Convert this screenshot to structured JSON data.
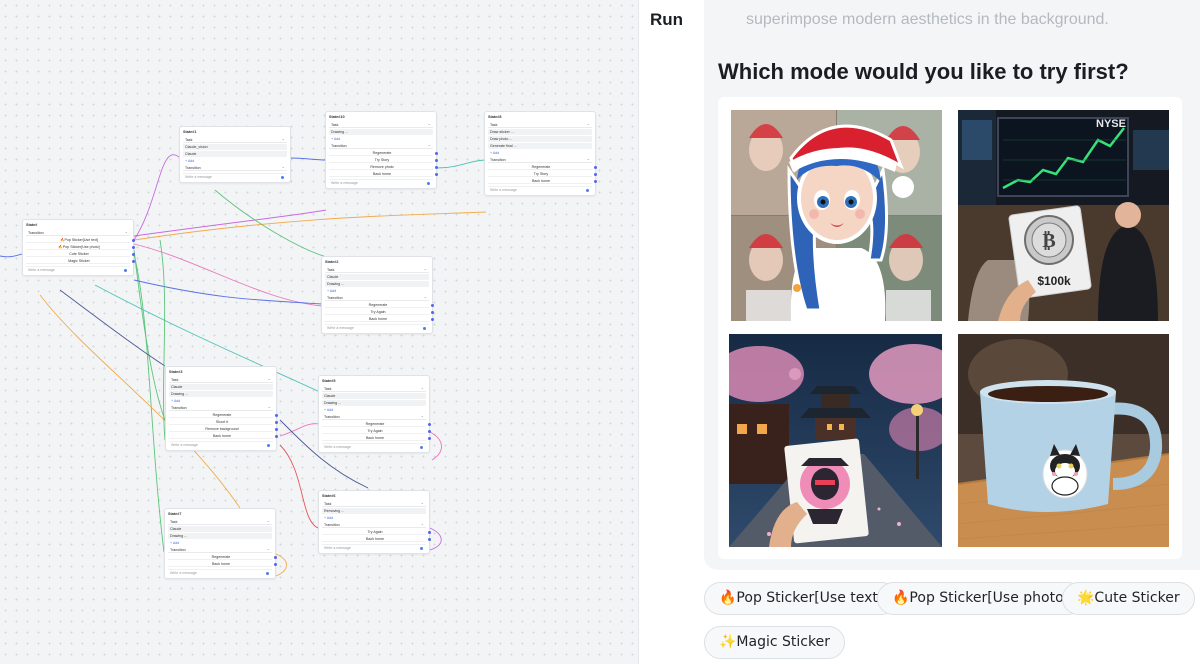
{
  "run_panel": {
    "title": "Run",
    "faded_message": "superimpose modern aesthetics in the background.",
    "question": "Which mode would you like to try first?",
    "images": [
      {
        "name": "christmas-girl-sticker",
        "sticker_text": ""
      },
      {
        "name": "bitcoin-stock-exchange-sticker",
        "sticker_text": "$100k"
      },
      {
        "name": "ninja-pagoda-sticker",
        "sticker_text": ""
      },
      {
        "name": "cat-mug-sticker",
        "sticker_text": ""
      }
    ],
    "buttons": [
      {
        "name": "pop-sticker-text-button",
        "label": "🔥Pop Sticker[Use text]"
      },
      {
        "name": "pop-sticker-photo-button",
        "label": "🔥Pop Sticker[Use photo]"
      },
      {
        "name": "cute-sticker-button",
        "label": "🌟Cute Sticker"
      },
      {
        "name": "magic-sticker-button",
        "label": "✨Magic Sticker"
      }
    ]
  },
  "canvas": {
    "nodes": [
      {
        "id": "state0",
        "title": "State#",
        "rows": [
          [
            "sel",
            "Transition"
          ],
          [
            "opt",
            "🔥Pop Sticker[Use text]"
          ],
          [
            "opt",
            "🔥Pop Sticker[Use photo]"
          ],
          [
            "opt",
            "Cute Sticker"
          ],
          [
            "opt",
            "Magic Sticker"
          ],
          [
            "msg",
            "Write a message"
          ]
        ]
      },
      {
        "id": "state1",
        "title": "State#1",
        "rows": [
          [
            "sel",
            "Task"
          ],
          [
            "field",
            "Claude_vision"
          ],
          [
            "field",
            "Claude"
          ],
          [
            "add",
            "+ Add"
          ],
          [
            "sel",
            "Transition"
          ],
          [
            "msg",
            "Write a message"
          ]
        ]
      },
      {
        "id": "state2",
        "title": "State#2",
        "rows": [
          [
            "sel",
            "Task"
          ],
          [
            "field",
            "Claude"
          ],
          [
            "field",
            "Drawing ..."
          ],
          [
            "add",
            "+ Add"
          ],
          [
            "sel",
            "Transition"
          ],
          [
            "opt",
            "Regenerate"
          ],
          [
            "opt",
            "Try Again"
          ],
          [
            "opt",
            "Back home"
          ],
          [
            "msg",
            "Write a message"
          ]
        ]
      },
      {
        "id": "state3",
        "title": "State#3",
        "rows": [
          [
            "sel",
            "Task"
          ],
          [
            "field",
            "Claude"
          ],
          [
            "field",
            "Drawing ..."
          ],
          [
            "add",
            "+ Add"
          ],
          [
            "sel",
            "Transition"
          ],
          [
            "opt",
            "Regenerate"
          ],
          [
            "opt",
            "Shoot it"
          ],
          [
            "opt",
            "Remove background"
          ],
          [
            "opt",
            "Back home"
          ],
          [
            "msg",
            "Write a message"
          ]
        ]
      },
      {
        "id": "state5",
        "title": "State#5",
        "rows": [
          [
            "sel",
            "Task"
          ],
          [
            "field",
            "Claude"
          ],
          [
            "field",
            "Drawing ..."
          ],
          [
            "add",
            "+ Add"
          ],
          [
            "sel",
            "Transition"
          ],
          [
            "opt",
            "Regenerate"
          ],
          [
            "opt",
            "Try Again"
          ],
          [
            "opt",
            "Back home"
          ],
          [
            "msg",
            "Write a message"
          ]
        ]
      },
      {
        "id": "state6",
        "title": "State#6",
        "rows": [
          [
            "sel",
            "Task"
          ],
          [
            "field",
            "Removing ..."
          ],
          [
            "add",
            "+ Add"
          ],
          [
            "sel",
            "Transition"
          ],
          [
            "opt",
            "Try Again"
          ],
          [
            "opt",
            "Back home"
          ],
          [
            "msg",
            "Write a message"
          ]
        ]
      },
      {
        "id": "state7",
        "title": "State#7",
        "rows": [
          [
            "sel",
            "Task"
          ],
          [
            "field",
            "Claude"
          ],
          [
            "field",
            "Drawing ..."
          ],
          [
            "add",
            "+ Add"
          ],
          [
            "sel",
            "Transition"
          ],
          [
            "opt",
            "Regenerate"
          ],
          [
            "opt",
            "Back home"
          ],
          [
            "msg",
            "Write a message"
          ]
        ]
      },
      {
        "id": "state8",
        "title": "State#8",
        "rows": [
          [
            "sel",
            "Task"
          ],
          [
            "field",
            "Draw sticker ..."
          ],
          [
            "field",
            "Draw photo ..."
          ],
          [
            "field",
            "Generate final ..."
          ],
          [
            "add",
            "+ Add"
          ],
          [
            "sel",
            "Transition"
          ],
          [
            "opt",
            "Regenerate"
          ],
          [
            "opt",
            "Try Story"
          ],
          [
            "opt",
            "Back home"
          ],
          [
            "msg",
            "Write a message"
          ]
        ]
      },
      {
        "id": "state10",
        "title": "State#10",
        "rows": [
          [
            "sel",
            "Task"
          ],
          [
            "field",
            "Drawing ..."
          ],
          [
            "add",
            "+ Add"
          ],
          [
            "sel",
            "Transition"
          ],
          [
            "opt",
            "Regenerate"
          ],
          [
            "opt",
            "Try Story"
          ],
          [
            "opt",
            "Remove photo"
          ],
          [
            "opt",
            "Back home"
          ],
          [
            "msg",
            "Write a message"
          ]
        ]
      }
    ]
  },
  "colors": {
    "edge_purple": "#c45be0",
    "edge_orange": "#f2a33a",
    "edge_green": "#4cc06e",
    "edge_teal": "#3bbfb0",
    "edge_blue": "#4a63e8",
    "edge_red": "#e8424a",
    "edge_pink": "#e76ab6",
    "edge_navy": "#3b4a8a"
  }
}
